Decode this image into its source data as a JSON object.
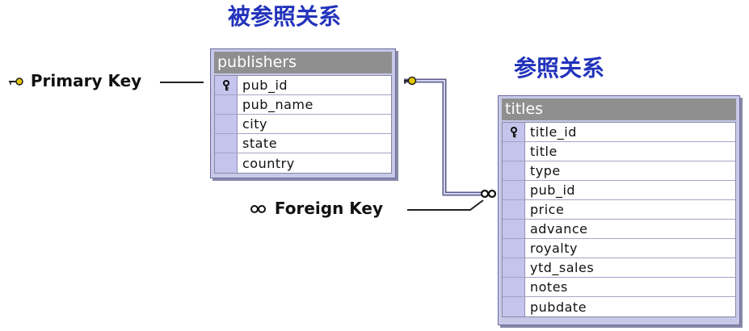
{
  "headings": {
    "referenced_relation": "被参照关系",
    "referencing_relation": "参照关系"
  },
  "labels": {
    "primary_key": "Primary Key",
    "foreign_key": "Foreign Key"
  },
  "colors": {
    "heading": "#2233bb",
    "table_title_bar": "#8f8f8f",
    "table_frame": "#c8c8e8",
    "key_cell": "#c4c4ec",
    "key_glyph": "#e6c800"
  },
  "icons": {
    "primary_key": "key-icon",
    "foreign_key": "infinity-icon"
  },
  "tables": {
    "publishers": {
      "title": "publishers",
      "columns": [
        {
          "name": "pub_id",
          "primary_key": true
        },
        {
          "name": "pub_name",
          "primary_key": false
        },
        {
          "name": "city",
          "primary_key": false
        },
        {
          "name": "state",
          "primary_key": false
        },
        {
          "name": "country",
          "primary_key": false
        }
      ]
    },
    "titles": {
      "title": "titles",
      "columns": [
        {
          "name": "title_id",
          "primary_key": true
        },
        {
          "name": "title",
          "primary_key": false
        },
        {
          "name": "type",
          "primary_key": false
        },
        {
          "name": "pub_id",
          "primary_key": false
        },
        {
          "name": "price",
          "primary_key": false
        },
        {
          "name": "advance",
          "primary_key": false
        },
        {
          "name": "royalty",
          "primary_key": false
        },
        {
          "name": "ytd_sales",
          "primary_key": false
        },
        {
          "name": "notes",
          "primary_key": false
        },
        {
          "name": "pubdate",
          "primary_key": false
        }
      ]
    }
  }
}
